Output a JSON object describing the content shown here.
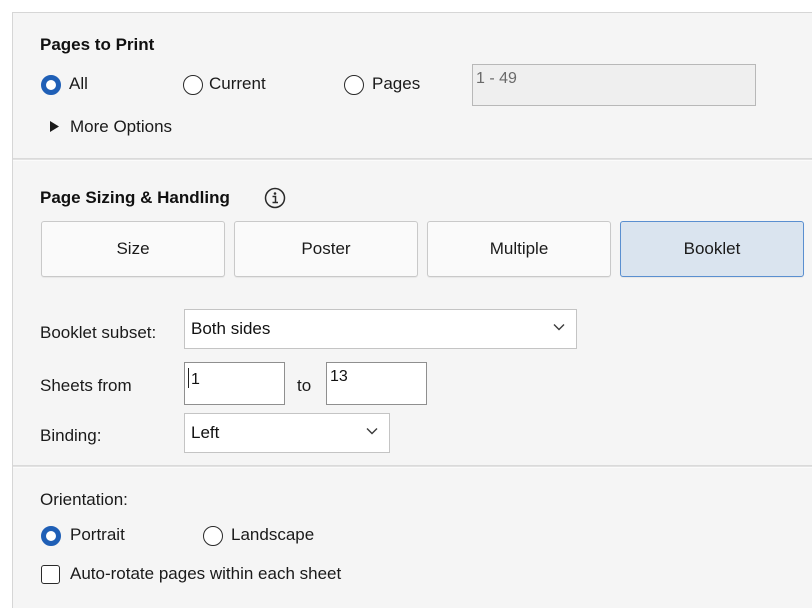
{
  "pages_to_print": {
    "heading": "Pages to Print",
    "options": [
      {
        "label": "All",
        "selected": true
      },
      {
        "label": "Current",
        "selected": false
      },
      {
        "label": "Pages",
        "selected": false
      }
    ],
    "pages_range_value": "1 - 49",
    "more_options_label": "More Options"
  },
  "page_sizing": {
    "heading": "Page Sizing & Handling",
    "info_icon": "info-icon",
    "modes": [
      {
        "label": "Size",
        "selected": false
      },
      {
        "label": "Poster",
        "selected": false
      },
      {
        "label": "Multiple",
        "selected": false
      },
      {
        "label": "Booklet",
        "selected": true
      }
    ],
    "booklet_subset_label": "Booklet subset:",
    "booklet_subset_value": "Both sides",
    "sheets_from_label": "Sheets from",
    "sheets_from_value": "1",
    "sheets_to_label": "to",
    "sheets_to_value": "13",
    "binding_label": "Binding:",
    "binding_value": "Left"
  },
  "orientation": {
    "heading": "Orientation:",
    "options": [
      {
        "label": "Portrait",
        "selected": true
      },
      {
        "label": "Landscape",
        "selected": false
      }
    ],
    "auto_rotate_label": "Auto-rotate pages within each sheet",
    "auto_rotate_checked": false
  },
  "colors": {
    "accent": "#1f5fb6",
    "selected_tab_bg": "#dae4ef",
    "panel_bg": "#f5f5f5"
  }
}
